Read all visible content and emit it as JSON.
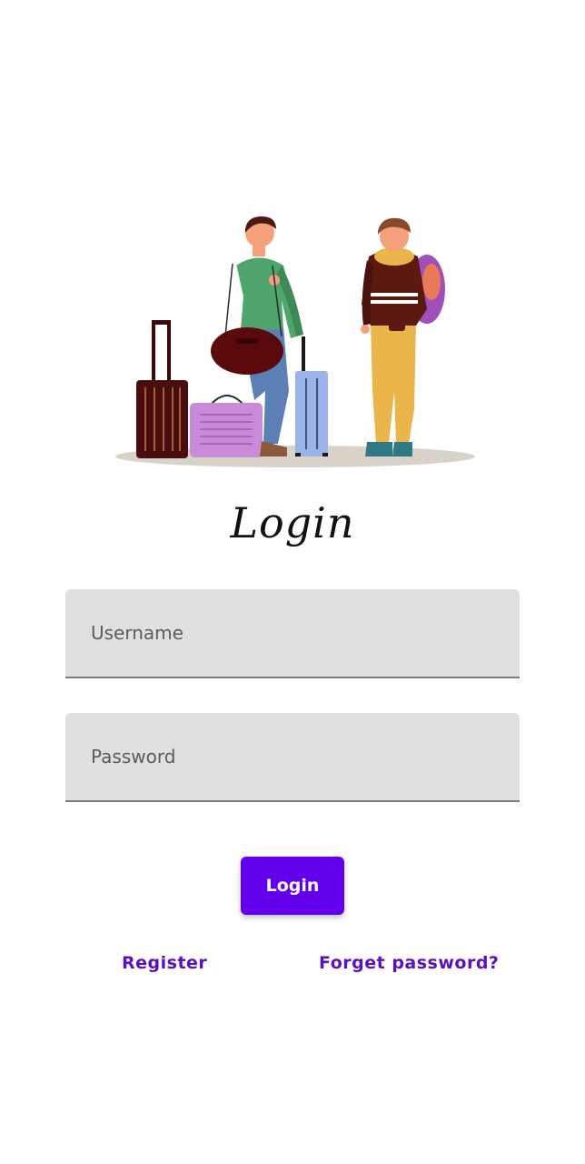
{
  "title": "Login",
  "username": {
    "placeholder": "Username",
    "value": ""
  },
  "password": {
    "placeholder": "Password",
    "value": ""
  },
  "login_button": "Login",
  "links": {
    "register": "Register",
    "forget_password": "Forget password?"
  },
  "colors": {
    "primary": "#6200ee",
    "link": "#5a0fc0",
    "field_bg": "#e0e0e0"
  },
  "illustration": "travelers-with-luggage-illustration"
}
